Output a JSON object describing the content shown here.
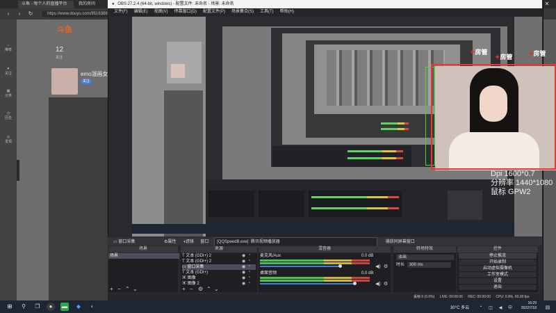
{
  "browser": {
    "tabs": [
      "斗鱼 - 每个人的直播平台",
      "我的房间"
    ],
    "url": "https://www.douyu.com/9516388?dyshid=0-...",
    "nav_icons": [
      "home-icon",
      "follow-icon",
      "category-icon",
      "history-icon",
      "discover-icon",
      "gift-icon"
    ],
    "nav_labels": [
      "推荐",
      "关注",
      "分类",
      "历史",
      "发现",
      "活动"
    ],
    "logo": "斗鱼",
    "stat_value": "12",
    "stat_label": "关注",
    "streamer_name": "emo湿画女主",
    "follow_label": "关注"
  },
  "obs": {
    "title": "OBS 27.2.4 (64-bit, windows) - 配置文件: 未命名 - 场景: 未命名",
    "menu": [
      "文件(F)",
      "编辑(E)",
      "视图(V)",
      "停靠窗口(D)",
      "配置文件(P)",
      "场景集合(S)",
      "工具(T)",
      "帮助(H)"
    ],
    "context_bar": {
      "source": "窗口采集",
      "properties": "属性",
      "filters": "滤镜",
      "window_label": "窗口",
      "window_value": "[QQSpeedB.exe]: 腾讯视频播放器",
      "capture_label": "捕获同屏幕窗口"
    },
    "docks": {
      "scenes": "场景",
      "sources": "来源",
      "mixer": "混音器",
      "transitions": "转场特效",
      "controls": "控件"
    },
    "scenes": [
      "场景"
    ],
    "sources": [
      {
        "icon": "text-icon",
        "name": "文本 (GDI+) 2"
      },
      {
        "icon": "text-icon",
        "name": "文本 (GDI+) 2"
      },
      {
        "icon": "window-icon",
        "name": "窗口采集"
      },
      {
        "icon": "text-icon",
        "name": "文本 (GDI+)"
      },
      {
        "icon": "image-icon",
        "name": "图像"
      },
      {
        "icon": "image-icon",
        "name": "图像 2"
      }
    ],
    "mixer": [
      {
        "name": "麦克风/Aux",
        "level": "0.0 dB",
        "volume": 0.72
      },
      {
        "name": "桌面音频",
        "level": "0.0 dB",
        "volume": 0.85
      }
    ],
    "transition": {
      "type": "淡出",
      "duration_label": "时长",
      "duration": "300 ms"
    },
    "controls": [
      "停止推流",
      "开始录制",
      "启动虚拟摄像机",
      "工作室模式",
      "设置",
      "退出"
    ],
    "status": {
      "drop": "丢帧 0 (0.0%)",
      "live": "LIVE: 00:00:00",
      "rec": "REC: 00:00:00",
      "cpu": "CPU: 0.9%, 60.00 fps"
    }
  },
  "overlay": {
    "camera_text": "Dpi 1600*0.7\n分辨率 1440*1080\n鼠标 GPW2",
    "gift_text": "房管"
  },
  "taskbar": {
    "icons": [
      "windows-icon",
      "search-icon",
      "task-view-icon",
      "obs-icon",
      "wechat-icon",
      "browser-icon",
      "edge-icon"
    ],
    "weather": "30°C 多云",
    "time": "16:29",
    "date": "2022/7/18"
  }
}
